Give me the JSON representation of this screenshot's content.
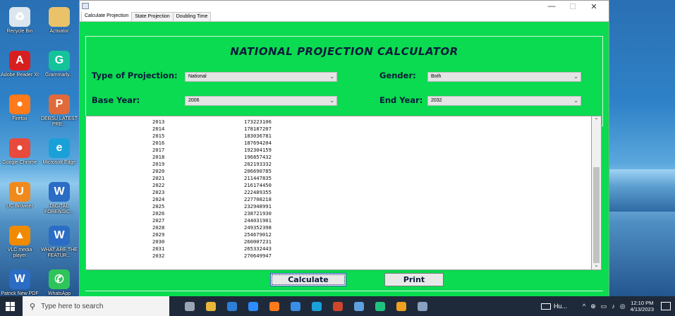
{
  "desktop": {
    "icons": [
      {
        "label": "Recycle Bin",
        "icon": "recycle-bin-icon",
        "color": "#dbe6ee",
        "glyph": "♻"
      },
      {
        "label": "Activator",
        "icon": "folder-icon",
        "color": "#e9c26a",
        "glyph": ""
      },
      {
        "label": "Adobe Reader XI",
        "icon": "adobe-reader-icon",
        "color": "#d81f1f",
        "glyph": "A"
      },
      {
        "label": "Grammarly...",
        "icon": "grammarly-icon",
        "color": "#15c39a",
        "glyph": "G"
      },
      {
        "label": "Firefox",
        "icon": "firefox-icon",
        "color": "#ff7a1a",
        "glyph": "●"
      },
      {
        "label": "DEBSU LATEST PRE...",
        "icon": "powerpoint-file-icon",
        "color": "#e06a3a",
        "glyph": "P"
      },
      {
        "label": "Google Chrome",
        "icon": "chrome-icon",
        "color": "#e84a3b",
        "glyph": "●"
      },
      {
        "label": "Microsoft Edge",
        "icon": "edge-icon",
        "color": "#1aa0d8",
        "glyph": "e"
      },
      {
        "label": "UC Browser",
        "icon": "uc-browser-icon",
        "color": "#f08a1c",
        "glyph": "U"
      },
      {
        "label": "DIGITAL FORENSIC...",
        "icon": "word-file-icon",
        "color": "#2b6cc4",
        "glyph": "W"
      },
      {
        "label": "VLC media player",
        "icon": "vlc-icon",
        "color": "#f08a00",
        "glyph": "▲"
      },
      {
        "label": "WHAT ARE THE FEATUR...",
        "icon": "word-file-icon",
        "color": "#2b6cc4",
        "glyph": "W"
      },
      {
        "label": "Patrick New PDF Projec...",
        "icon": "word-file-icon",
        "color": "#2b6cc4",
        "glyph": "W"
      },
      {
        "label": "WhatsApp",
        "icon": "whatsapp-icon",
        "color": "#2ec45a",
        "glyph": "✆"
      }
    ]
  },
  "window": {
    "controls": {
      "minimize": "—",
      "maximize": "☐",
      "close": "✕"
    },
    "tabs": [
      "Calculate Projection",
      "State Projection",
      "Doubling Time"
    ],
    "active_tab": 0
  },
  "form": {
    "heading": "NATIONAL PROJECTION CALCULATOR",
    "type_label": "Type of Projection:",
    "type_value": "National",
    "gender_label": "Gender:",
    "gender_value": "Both",
    "base_year_label": "Base Year:",
    "base_year_value": "2006",
    "end_year_label": "End Year:",
    "end_year_value": "2032"
  },
  "results": {
    "rows": [
      {
        "year": "2013",
        "value": "173223106"
      },
      {
        "year": "2014",
        "value": "178187207"
      },
      {
        "year": "2015",
        "value": "183036781"
      },
      {
        "year": "2016",
        "value": "187694204"
      },
      {
        "year": "2017",
        "value": "192304159"
      },
      {
        "year": "2018",
        "value": "196857432"
      },
      {
        "year": "2019",
        "value": "202193332"
      },
      {
        "year": "2020",
        "value": "206690785"
      },
      {
        "year": "2021",
        "value": "211447835"
      },
      {
        "year": "2022",
        "value": "216174450"
      },
      {
        "year": "2023",
        "value": "222489355"
      },
      {
        "year": "2024",
        "value": "227708218"
      },
      {
        "year": "2025",
        "value": "232948991"
      },
      {
        "year": "2026",
        "value": "238721930"
      },
      {
        "year": "2027",
        "value": "244031901"
      },
      {
        "year": "2028",
        "value": "249352398"
      },
      {
        "year": "2029",
        "value": "254679012"
      },
      {
        "year": "2030",
        "value": "260007231"
      },
      {
        "year": "2031",
        "value": "265332443"
      },
      {
        "year": "2032",
        "value": "270649947"
      }
    ]
  },
  "buttons": {
    "calculate": "Calculate",
    "print": "Print"
  },
  "taskbar": {
    "search_placeholder": "Type here to search",
    "apps": [
      {
        "icon": "task-view-icon",
        "color": "#9aa6b4"
      },
      {
        "icon": "file-explorer-icon",
        "color": "#e8b73a"
      },
      {
        "icon": "mail-icon",
        "color": "#2d7fd8"
      },
      {
        "icon": "zoom-icon",
        "color": "#2d8cff"
      },
      {
        "icon": "firefox-icon",
        "color": "#ff7a1a"
      },
      {
        "icon": "store-icon",
        "color": "#3a8ee6"
      },
      {
        "icon": "edge-icon",
        "color": "#1aa0d8"
      },
      {
        "icon": "powerpoint-icon",
        "color": "#d0462a"
      },
      {
        "icon": "network-app-icon",
        "color": "#5fa0e0"
      },
      {
        "icon": "pycharm-icon",
        "color": "#1ec47e"
      },
      {
        "icon": "photo-app-icon",
        "color": "#f0a020"
      },
      {
        "icon": "java-app-icon",
        "color": "#8aa0c0"
      }
    ],
    "tray_app_label": "Hu...",
    "time": "12:10 PM",
    "date": "4/13/2023"
  }
}
